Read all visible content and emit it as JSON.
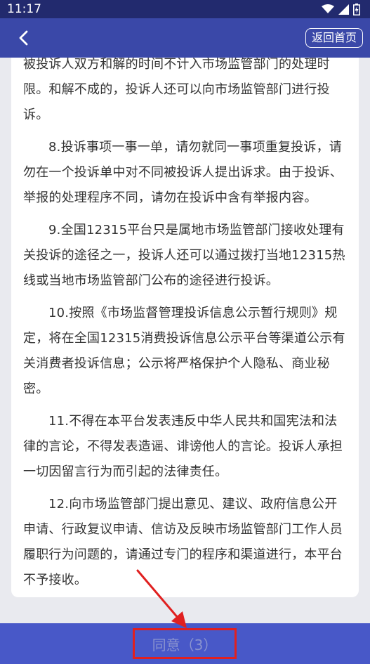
{
  "status_bar": {
    "time": "11:17",
    "icons": [
      "wifi-icon",
      "cellular-signal-icon",
      "battery-icon"
    ]
  },
  "nav": {
    "back_icon": "chevron-left-icon",
    "home_button": "返回首页"
  },
  "content": {
    "paragraphs": [
      "被投诉人双方和解的时间不计入市场监管部门的处理时限。和解不成的，投诉人还可以向市场监管部门进行投诉。",
      "8.投诉事项一事一单，请勿就同一事项重复投诉，请勿在一个投诉单中对不同被投诉人提出诉求。由于投诉、举报的处理程序不同，请勿在投诉中含有举报内容。",
      "9.全国12315平台只是属地市场监管部门接收处理有关投诉的途径之一，投诉人还可以通过拨打当地12315热线或当地市场监管部门公布的途径进行投诉。",
      "10.按照《市场监督管理投诉信息公示暂行规则》规定，将在全国12315消费投诉信息公示平台等渠道公示有关消费者投诉信息；公示将严格保护个人隐私、商业秘密。",
      "11.不得在本平台发表违反中华人民共和国宪法和法律的言论，不得发表造谣、诽谤他人的言论。投诉人承担一切因留言行为而引起的法律责任。",
      "12.向市场监管部门提出意见、建议、政府信息公开申请、行政复议申请、信访及反映市场监管部门工作人员履职行为问题的，请通过专门的程序和渠道进行，本平台不予接收。"
    ]
  },
  "footer": {
    "agree_button": "同意（3）"
  },
  "colors": {
    "status_bar": "#222a6e",
    "nav_bar": "#3a48a8",
    "bottom_bar": "#4858c8",
    "highlight": "#e02020"
  }
}
